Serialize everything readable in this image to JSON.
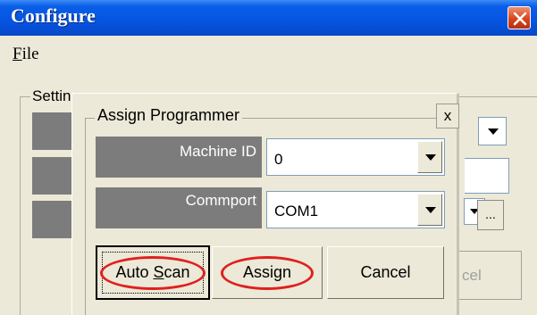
{
  "window": {
    "title": "Configure",
    "close_icon": "close-icon"
  },
  "menu": {
    "file_mnemonic": "F",
    "file_rest": "ile"
  },
  "settings": {
    "legend": "Setting"
  },
  "background": {
    "ellipsis_label": "...",
    "cancel_partial_label": "cel"
  },
  "dialog": {
    "title": "Assign Programmer",
    "close_label": "x",
    "machine_id": {
      "label": "Machine ID",
      "value": "0"
    },
    "commport": {
      "label": "Commport",
      "value": "COM1"
    },
    "buttons": {
      "auto_scan_pre": "Auto ",
      "auto_scan_mnemonic": "S",
      "auto_scan_post": "can",
      "assign": "Assign",
      "cancel": "Cancel"
    }
  },
  "annotations": {
    "highlight_color": "#e02020"
  }
}
